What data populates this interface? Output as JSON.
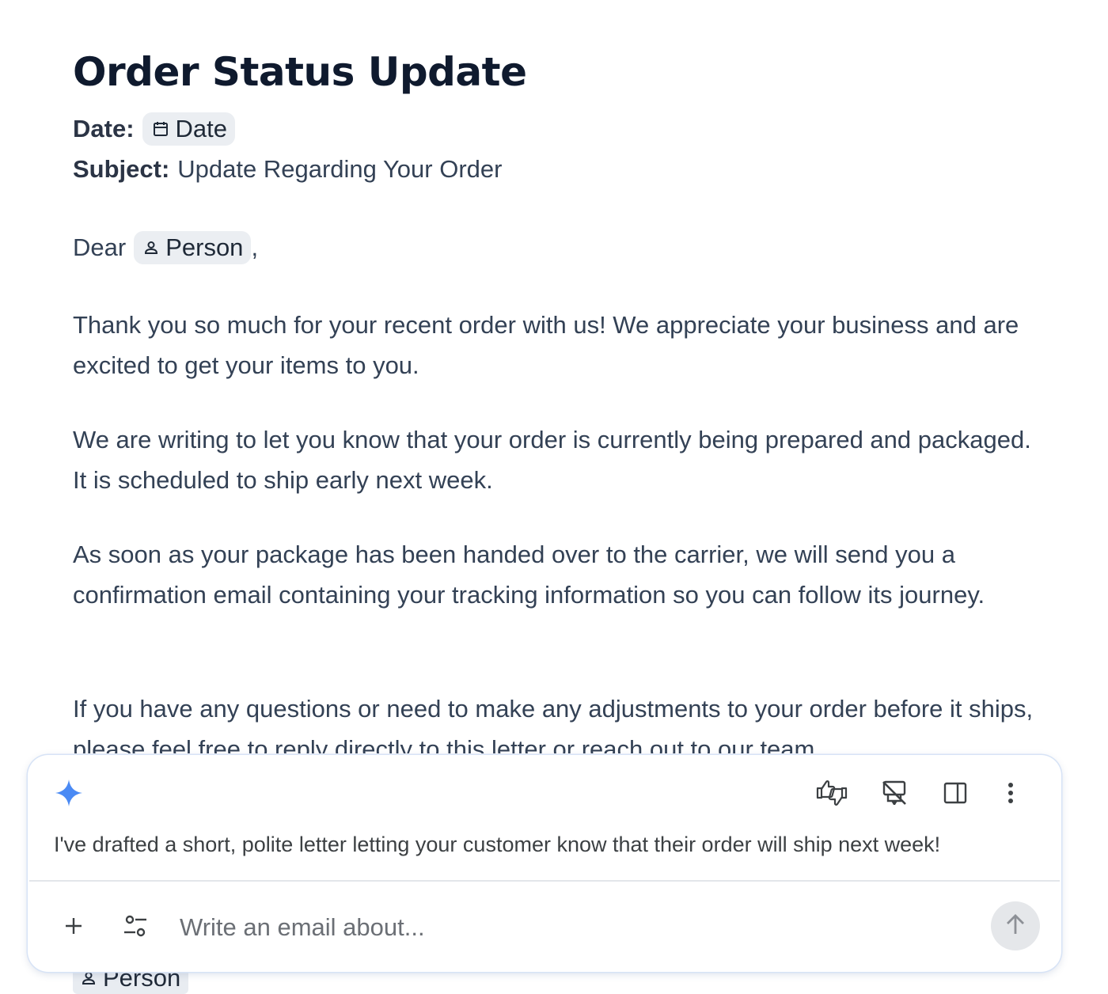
{
  "document": {
    "title": "Order Status Update",
    "date_label": "Date:",
    "date_chip": "Date",
    "subject_label": "Subject:",
    "subject_value": "Update Regarding Your Order",
    "salutation": "Dear",
    "person_chip": "Person",
    "salutation_end": ",",
    "paragraphs": [
      "Thank you so much for your recent order with us! We appreciate your business and are excited to get your items to you.",
      "We are writing to let you know that your order is currently being prepared and packaged. It is scheduled to ship early next week.",
      "As soon as your package has been handed over to the carrier, we will send you a confirmation email containing your tracking information so you can follow its journey.",
      "If you have any questions or need to make any adjustments to your order before it ships, please feel free to reply directly to this letter or reach out to our team."
    ],
    "signature_chip": "Person"
  },
  "assistant": {
    "icon": "sparkle-icon",
    "message": "I've drafted a short, polite letter letting your customer know that their order will ship next week!",
    "toolbar": [
      "thumbs-feedback-icon",
      "hide-icon",
      "side-panel-icon",
      "more-vert-icon"
    ],
    "input": {
      "placeholder": "Write an email about...",
      "value": ""
    },
    "accent_color": "#4285f4"
  }
}
